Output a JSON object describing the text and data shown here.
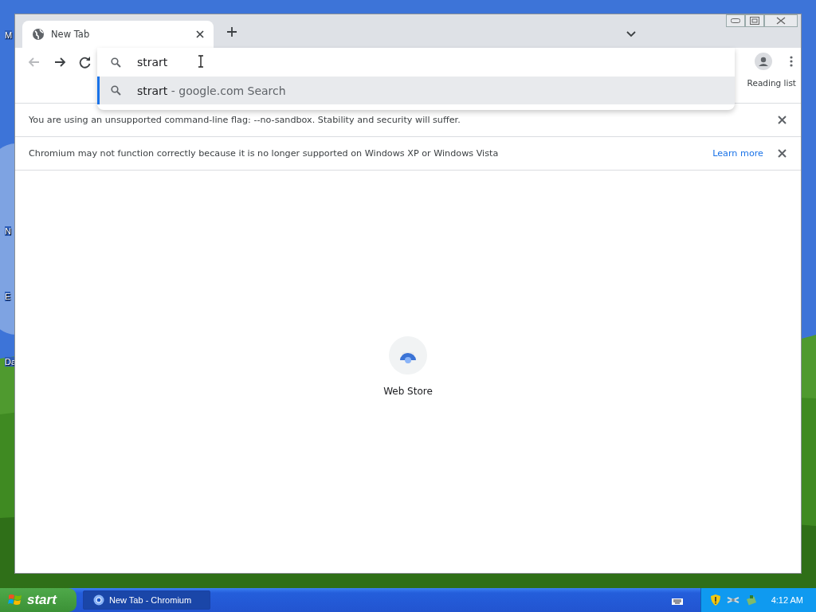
{
  "desktop": {
    "icon_labels": [
      {
        "text": "M"
      },
      {
        "text": "N"
      },
      {
        "text": "E"
      },
      {
        "text": "Da"
      }
    ]
  },
  "browser": {
    "tabs": [
      {
        "title": "New Tab",
        "selected": true
      }
    ],
    "nav": [
      {
        "kind": "back",
        "disabled": true
      },
      {
        "kind": "forward",
        "disabled": false
      },
      {
        "kind": "reload",
        "disabled": false
      }
    ],
    "omnibox": {
      "value": "strart"
    },
    "suggestions": [
      {
        "query": "strart",
        "description": "- google.com Search",
        "selected": true
      }
    ],
    "reading_list": "Reading list",
    "infobars": [
      {
        "message": "You are using an unsupported command-line flag: --no-sandbox. Stability and security will suffer."
      },
      {
        "message": "Chromium may not function correctly because it is no longer supported on Windows XP or Windows Vista",
        "link": "Learn more"
      }
    ],
    "shortcuts": [
      {
        "title": "Web Store"
      }
    ]
  },
  "taskbar": {
    "start": "start",
    "tasks": [
      {
        "title": "New Tab - Chromium",
        "selected": true
      }
    ],
    "clock": "4:12 AM"
  }
}
